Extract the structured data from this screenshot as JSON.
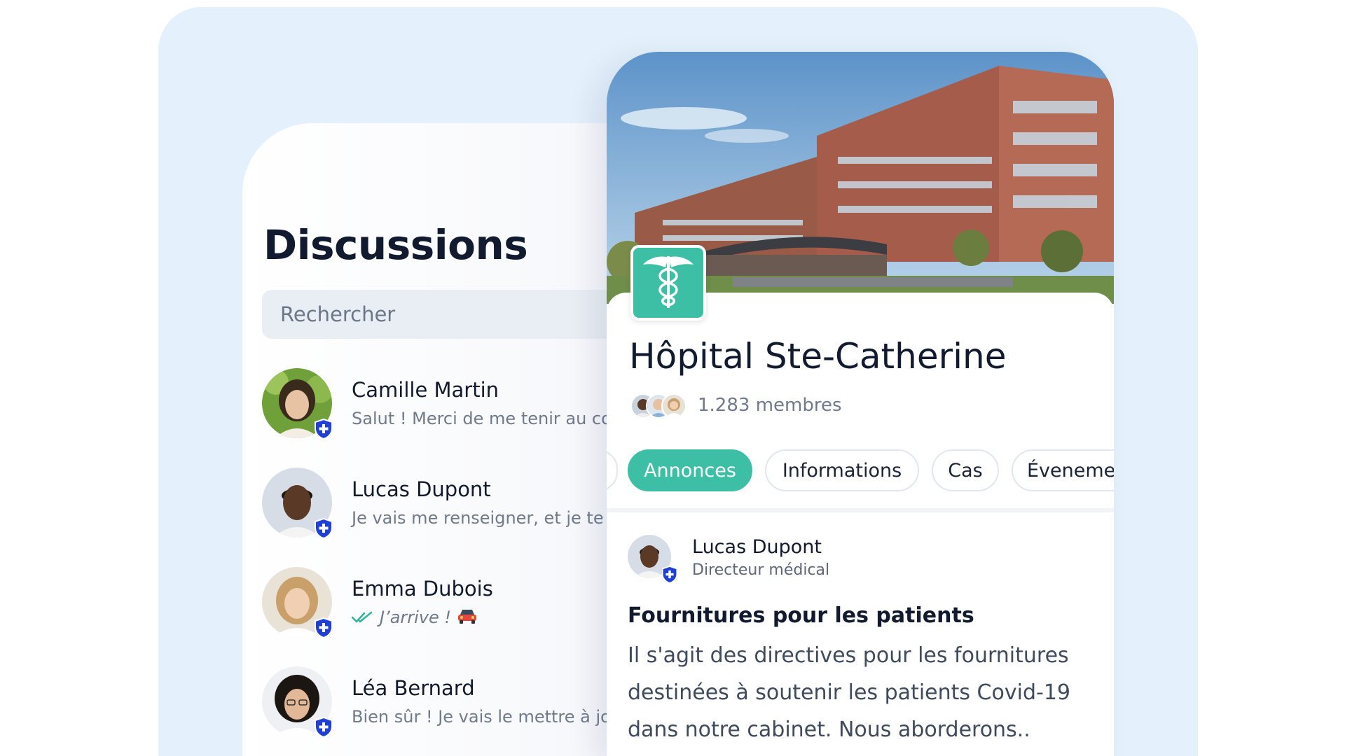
{
  "colors": {
    "accent_teal": "#3dbfa6",
    "badge_blue": "#1f3fd6",
    "background_panel": "#e4f0fb",
    "text_dark": "#111a2e",
    "text_muted": "#6f7a8c"
  },
  "discussions": {
    "title": "Discussions",
    "search_placeholder": "Rechercher",
    "conversations": [
      {
        "name": "Camille Martin",
        "preview": "Salut ! Merci de me tenir au cou",
        "avatar_icon": "avatar-camille"
      },
      {
        "name": "Lucas Dupont",
        "preview": "Je vais me renseigner, et je te ti",
        "avatar_icon": "avatar-lucas"
      },
      {
        "name": "Emma Dubois",
        "preview": "J’arrive !",
        "read_icon": "double-check-icon",
        "emoji_icon": "car-icon",
        "avatar_icon": "avatar-emma"
      },
      {
        "name": "Léa Bernard",
        "preview": "Bien sûr ! Je vais le mettre à jou",
        "avatar_icon": "avatar-lea"
      }
    ]
  },
  "hospital": {
    "name": "Hôpital Ste-Catherine",
    "members": "1.283 membres",
    "logo_icon": "caduceus-icon",
    "tabs": [
      {
        "label": "Annonces",
        "active": true
      },
      {
        "label": "Informations",
        "active": false
      },
      {
        "label": "Cas",
        "active": false
      },
      {
        "label": "Éveneme",
        "active": false
      }
    ],
    "post": {
      "author": "Lucas Dupont",
      "role": "Directeur médical",
      "title": "Fournitures pour les patients",
      "body": "Il s'agit des directives pour les fournitures destinées à soutenir les patients Covid-19 dans notre cabinet. Nous aborderons.."
    }
  }
}
